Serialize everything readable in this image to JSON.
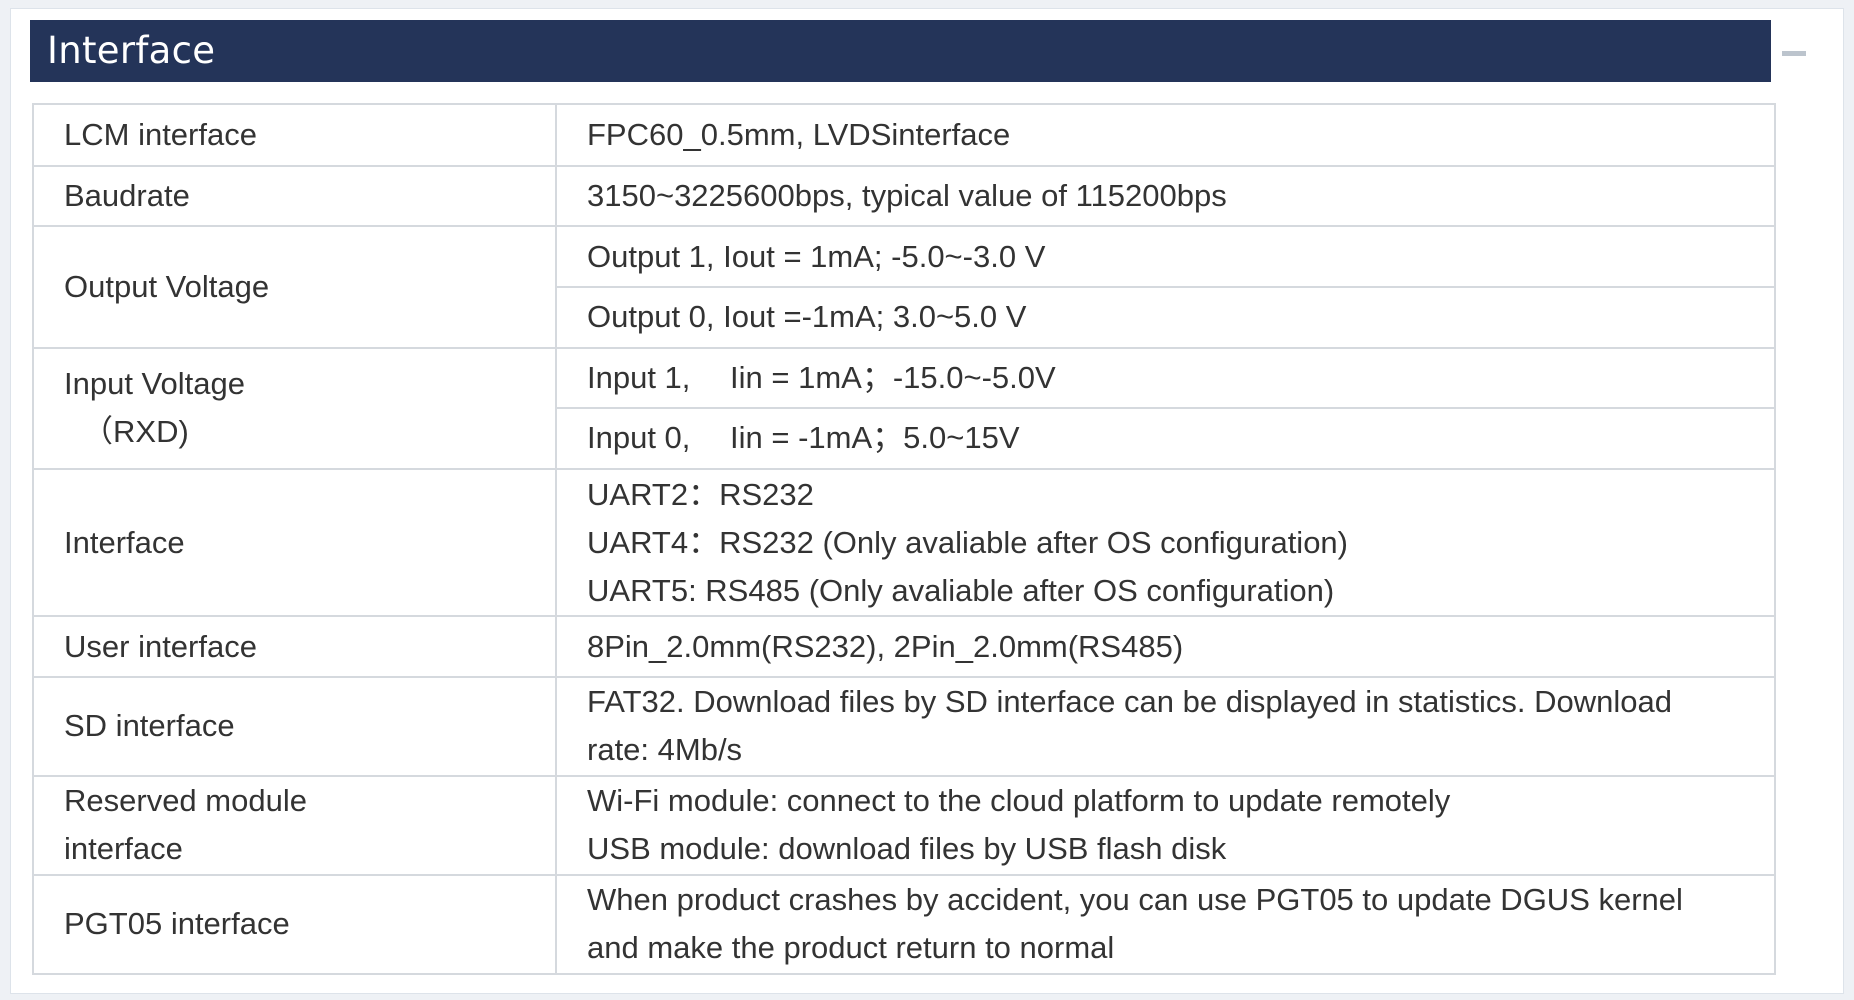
{
  "section": {
    "title": "Interface",
    "collapse_icon": "minus-icon"
  },
  "rows": [
    {
      "label": "LCM interface",
      "value": "FPC60_0.5mm, LVDSinterface"
    },
    {
      "label": "Baudrate",
      "value": "3150~3225600bps, typical value of 115200bps"
    },
    {
      "label": "Output Voltage",
      "values": [
        "Output 1, Iout = 1mA; -5.0~-3.0 V",
        "Output 0, Iout =-1mA; 3.0~5.0 V"
      ]
    },
    {
      "label_lines": [
        "Input Voltage",
        "（RXD)"
      ],
      "values": [
        "Input 1,　 Iin = 1mA；-15.0~-5.0V",
        "Input 0,　 Iin = -1mA；5.0~15V"
      ]
    },
    {
      "label": "Interface",
      "lines": [
        "UART2：RS232",
        "UART4：RS232 (Only avaliable after OS configuration)",
        "UART5:  RS485 (Only avaliable after OS configuration)"
      ]
    },
    {
      "label": "User interface",
      "value": "8Pin_2.0mm(RS232), 2Pin_2.0mm(RS485)"
    },
    {
      "label": "SD interface",
      "value": "FAT32. Download files by SD interface can be displayed in statistics. Download rate: 4Mb/s"
    },
    {
      "label_lines": [
        "Reserved module",
        "interface"
      ],
      "lines": [
        "Wi-Fi module: connect to the cloud platform to update remotely",
        "USB module: download files by USB flash disk"
      ]
    },
    {
      "label": "PGT05 interface",
      "value": "When product crashes by accident, you can use PGT05 to update DGUS kernel and make the product return to normal"
    }
  ]
}
